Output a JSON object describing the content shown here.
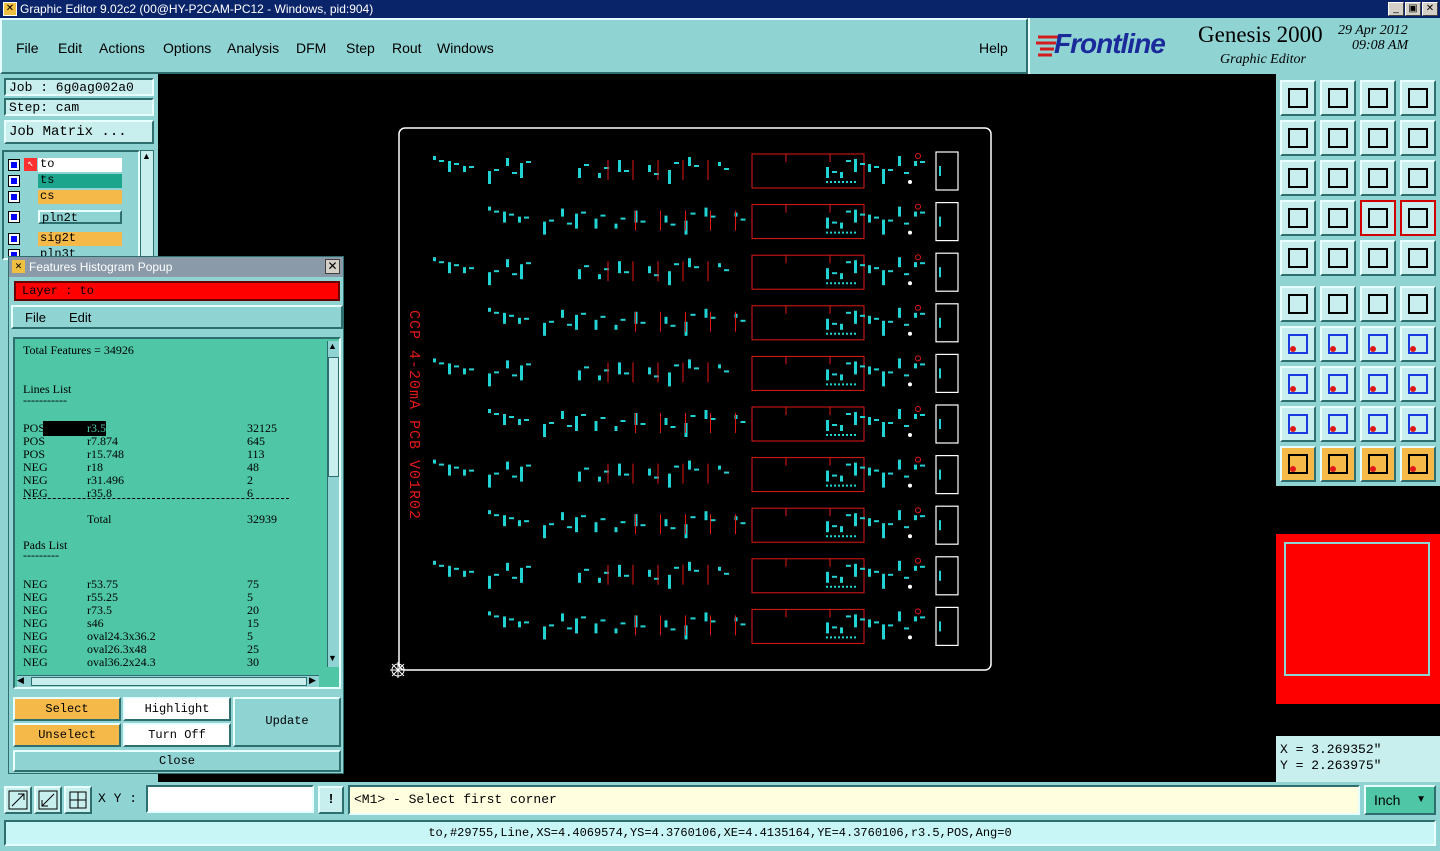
{
  "window": {
    "title": "Graphic Editor 9.02c2 (00@HY-P2CAM-PC12 - Windows, pid:904)",
    "controls": [
      "_",
      "▣",
      "✕"
    ]
  },
  "menu": [
    "File",
    "Edit",
    "Actions",
    "Options",
    "Analysis",
    "DFM",
    "Step",
    "Rout",
    "Windows"
  ],
  "help_label": "Help",
  "brand": {
    "logo": "Frontline",
    "product": "Genesis 2000",
    "subtitle": "Graphic Editor",
    "date": "29 Apr 2012",
    "time": "09:08 AM"
  },
  "job": {
    "job_line": "Job : 6g0ag002a0",
    "step_line": "Step: cam",
    "matrix_button": "Job Matrix ..."
  },
  "layers": [
    {
      "name": "to",
      "color": "#ffffff"
    },
    {
      "name": "ts",
      "color": "#1aa58c"
    },
    {
      "name": "cs",
      "color": "#f5b94a"
    },
    {
      "name": "pln2t",
      "color": "#8fd3d3"
    },
    {
      "name": "sig2t",
      "color": "#f5b94a"
    },
    {
      "name": "pln3t",
      "color": "#8fd3d3"
    }
  ],
  "popup": {
    "title": "Features Histogram Popup",
    "layer_label": "Layer :  to",
    "menu": [
      "File",
      "Edit"
    ],
    "total_features": "Total Features = 34926",
    "lines_header": "Lines List",
    "lines": [
      {
        "pol": "POS",
        "sym": "r3.5",
        "count": "32125"
      },
      {
        "pol": "POS",
        "sym": "r7.874",
        "count": "645"
      },
      {
        "pol": "POS",
        "sym": "r15.748",
        "count": "113"
      },
      {
        "pol": "NEG",
        "sym": "r18",
        "count": "48"
      },
      {
        "pol": "NEG",
        "sym": "r31.496",
        "count": "2"
      },
      {
        "pol": "NEG",
        "sym": "r35.8",
        "count": "6"
      }
    ],
    "lines_total_label": "Total",
    "lines_total": "32939",
    "pads_header": "Pads List",
    "pads": [
      {
        "pol": "NEG",
        "sym": "r53.75",
        "count": "75"
      },
      {
        "pol": "NEG",
        "sym": "r55.25",
        "count": "5"
      },
      {
        "pol": "NEG",
        "sym": "r73.5",
        "count": "20"
      },
      {
        "pol": "NEG",
        "sym": "s46",
        "count": "15"
      },
      {
        "pol": "NEG",
        "sym": "oval24.3x36.2",
        "count": "5"
      },
      {
        "pol": "NEG",
        "sym": "oval26.3x48",
        "count": "25"
      },
      {
        "pol": "NEG",
        "sym": "oval36.2x24.3",
        "count": "30"
      }
    ],
    "buttons": {
      "select": "Select",
      "highlight": "Highlight",
      "update": "Update",
      "unselect": "Unselect",
      "turn_off": "Turn Off",
      "close": "Close"
    }
  },
  "board": {
    "label": "CCP 4-20mA PCB V01R02"
  },
  "coords": {
    "x": "X = 3.269352\"",
    "y": "Y = 2.263975\""
  },
  "bottom": {
    "xy_label": "X Y :",
    "xy_value": "",
    "prompt": "<M1> - Select first corner",
    "units": "Inch"
  },
  "status": "to,#29755,Line,XS=4.4069574,YS=4.3760106,XE=4.4135164,YE=4.3760106,r3.5,POS,Ang=0",
  "colors": {
    "panel": "#8fd3d3",
    "pcb_cyan": "#22d3d3",
    "pcb_red": "#e01818",
    "selected_layer": "#ff0000",
    "popup_list_bg": "#4fc7a6",
    "button_orange": "#f5b94a"
  }
}
